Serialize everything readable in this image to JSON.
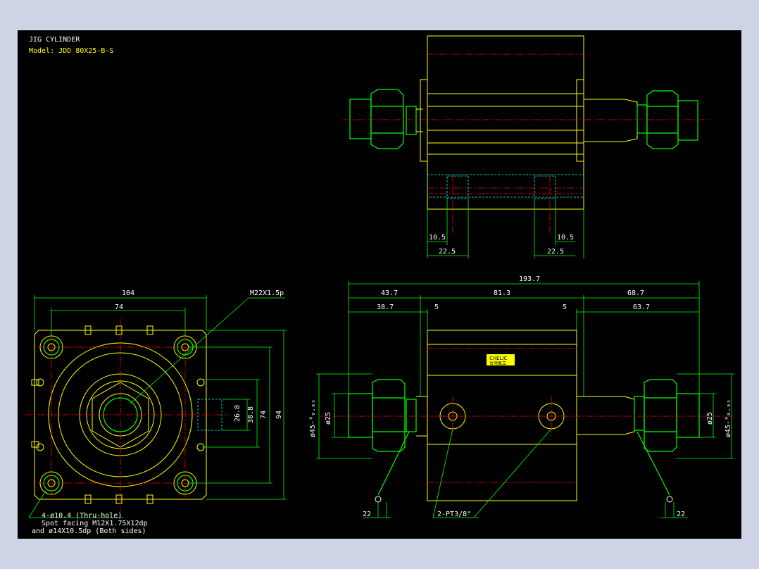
{
  "title_block": {
    "title": "JIG CYLINDER",
    "model": "Model: JDD 80X25-B-S"
  },
  "logo": {
    "text": "CHELIC",
    "sub": "台灣氣立"
  },
  "dimensions": {
    "top_left_10_5": "10.5",
    "top_right_10_5": "10.5",
    "top_left_22_5": "22.5",
    "top_right_22_5": "22.5",
    "overall_193_7": "193.7",
    "left_43_7": "43.7",
    "mid_81_3": "81.3",
    "right_68_7": "68.7",
    "left_38_7": "38.7",
    "left_5": "5",
    "right_5": "5",
    "right_63_7": "63.7",
    "front_104": "104",
    "front_74": "74",
    "front_26_8": "26.8",
    "front_38_8": "38.8",
    "front_74v": "74",
    "front_94": "94",
    "left_d45": "ø45-⁰₀.₀₅",
    "left_d25": "ø25",
    "right_d25": "ø25",
    "right_d45": "ø45-⁰₀.₀₅",
    "bottom_left_22": "22",
    "bottom_right_22": "22"
  },
  "callouts": {
    "thread": "M22X1.5p",
    "ports": "2-PT3/8\"",
    "holes_line1": "4-ø10.4 (Thru-hole)",
    "holes_line2": "Spot facing  M12X1.75X12dp",
    "holes_line3": "and ø14X10.5dp (Both sides)"
  },
  "colors": {
    "background": "#000000",
    "outline": "#ffff00",
    "dimension": "#00ff00",
    "centerline": "#ff0000",
    "hidden": "#00ffff",
    "text": "#ffffff"
  }
}
